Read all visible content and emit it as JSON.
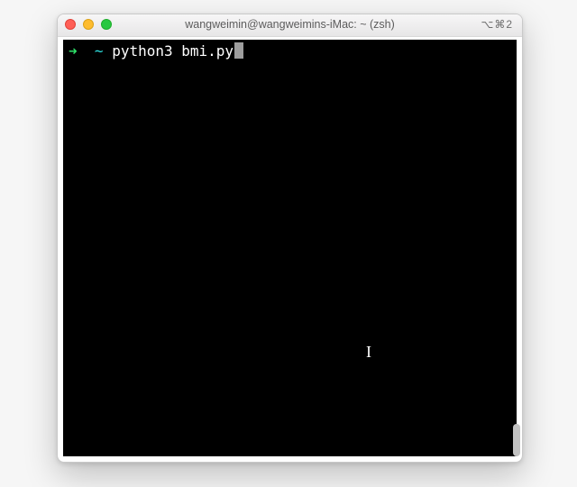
{
  "window": {
    "title": "wangweimin@wangweimins-iMac: ~ (zsh)",
    "shortcut": "⌥⌘2"
  },
  "traffic": {
    "close": "close",
    "minimize": "minimize",
    "zoom": "zoom"
  },
  "prompt": {
    "arrow": "➜",
    "path": "~",
    "command": "python3 bmi.py"
  },
  "pointer": {
    "glyph": "I"
  }
}
